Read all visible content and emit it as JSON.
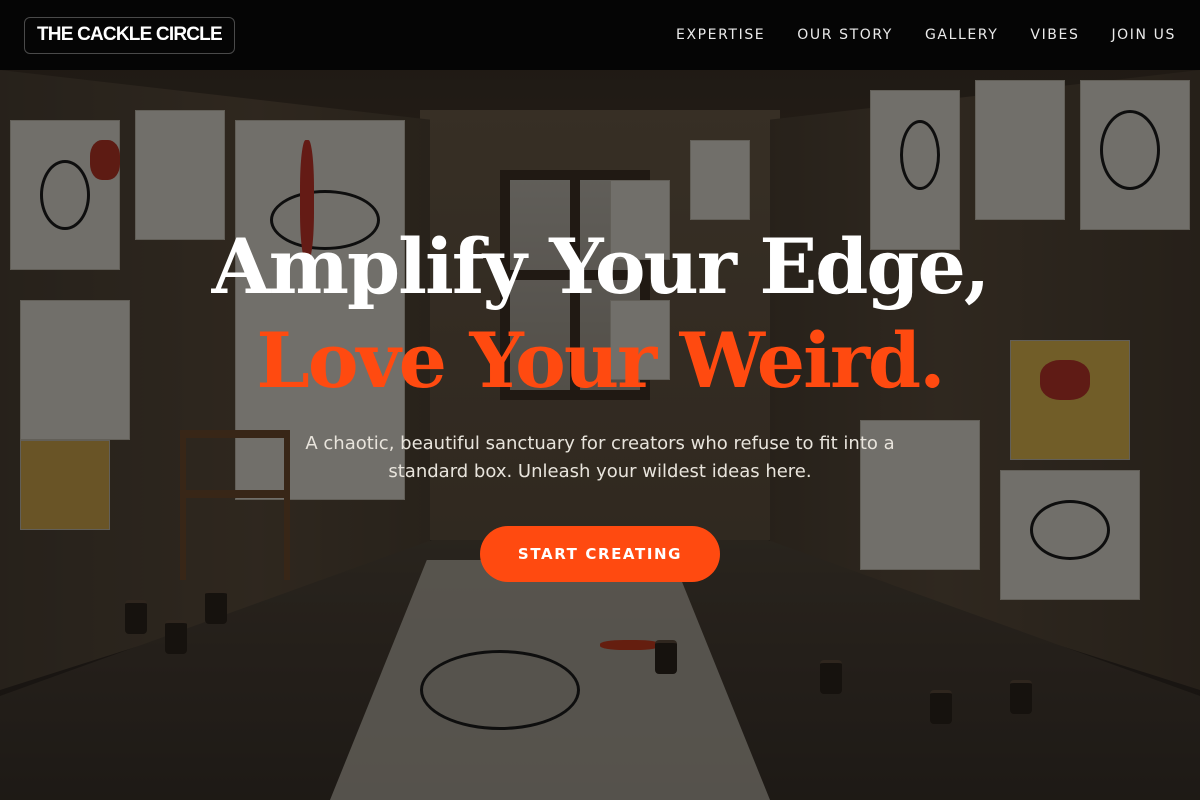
{
  "navbar": {
    "logo": "THE CACKLE CIRCLE",
    "links": [
      "EXPERTISE",
      "OUR STORY",
      "GALLERY",
      "VIBES",
      "JOIN US"
    ]
  },
  "hero": {
    "headline_line1": "Amplify Your Edge,",
    "headline_line2": "Love Your Weird.",
    "subtitle": "A chaotic, beautiful sanctuary for creators who refuse to fit into a standard box. Unleash your wildest ideas here.",
    "cta_label": "START CREATING"
  },
  "colors": {
    "accent": "#ff4a10",
    "nav_background": "#050505",
    "headline_white": "#ffffff"
  },
  "icons": {
    "background": "art-studio-photo"
  }
}
